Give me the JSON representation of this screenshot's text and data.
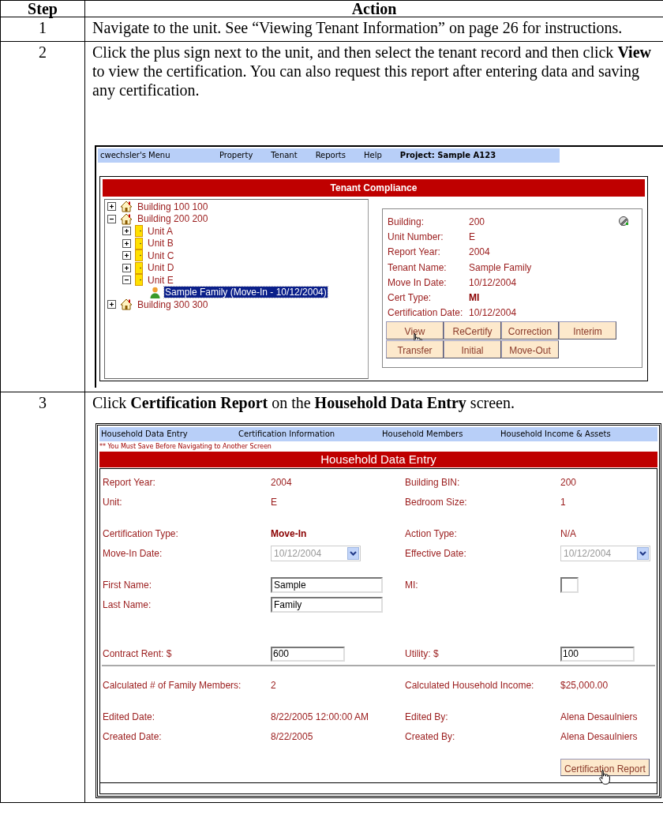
{
  "table": {
    "columns": [
      "Step",
      "Action"
    ],
    "rows": [
      {
        "step": "1",
        "text": "Navigate to the unit. See “Viewing Tenant Information” on page 26 for instructions."
      },
      {
        "step": "2",
        "text": "Click the plus sign next to the unit, and then select the tenant record and then click **View** to view the certification. You can also request this report after entering data and saving any certification.",
        "screen": {
          "kind": "tenant_compliance",
          "menu": [
            "cwechsler's Menu",
            "Property",
            "Tenant",
            "Reports",
            "Help"
          ],
          "project": "Project: Sample A123",
          "title": "Tenant Compliance",
          "tree": [
            {
              "label": "Building 100 100",
              "kind": "building",
              "expanded": false,
              "selected": false
            },
            {
              "label": "Building 200 200",
              "kind": "building",
              "expanded": true,
              "selected": false,
              "children": [
                {
                  "label": "Unit A",
                  "kind": "unit",
                  "expanded": false,
                  "selected": false
                },
                {
                  "label": "Unit B",
                  "kind": "unit",
                  "expanded": false,
                  "selected": false
                },
                {
                  "label": "Unit C",
                  "kind": "unit",
                  "expanded": false,
                  "selected": false
                },
                {
                  "label": "Unit D",
                  "kind": "unit",
                  "expanded": false,
                  "selected": false
                },
                {
                  "label": "Unit E",
                  "kind": "unit",
                  "expanded": true,
                  "selected": false,
                  "children": [
                    {
                      "label": "Sample Family (Move-In - 10/12/2004)",
                      "kind": "tenant",
                      "selected": true
                    }
                  ]
                }
              ]
            },
            {
              "label": "Building 300 300",
              "kind": "building",
              "expanded": false,
              "selected": false
            }
          ],
          "details": [
            {
              "label": "Building:",
              "value": "200",
              "strong": false
            },
            {
              "label": "Unit Number:",
              "value": "E",
              "strong": false
            },
            {
              "label": "Report Year:",
              "value": "2004",
              "strong": false
            },
            {
              "label": "Tenant Name:",
              "value": "Sample Family",
              "strong": false
            },
            {
              "label": "Move In Date:",
              "value": "10/12/2004",
              "strong": false
            },
            {
              "label": "Cert Type:",
              "value": "MI",
              "strong": true
            },
            {
              "label": "Certification Date:",
              "value": "10/12/2004",
              "strong": false
            }
          ],
          "button_rows": [
            [
              {
                "label": "View",
                "pointer": true
              },
              {
                "label": "ReCertify",
                "pointer": false
              },
              {
                "label": "Correction",
                "pointer": false
              },
              {
                "label": "Interim",
                "pointer": false
              }
            ],
            [
              {
                "label": "Transfer",
                "pointer": false
              },
              {
                "label": "Initial",
                "pointer": false
              },
              {
                "label": "Move-Out",
                "pointer": false
              }
            ]
          ]
        }
      },
      {
        "step": "3",
        "text": "Click **Certification Report** on the **Household Data Entry** screen.",
        "screen": {
          "kind": "household_data_entry",
          "nav": [
            "Household Data Entry",
            "Certification Information",
            "Household Members",
            "Household Income & Assets"
          ],
          "warning": "** You Must Save Before Navigating to Another Screen",
          "title": "Household Data Entry",
          "groups": [
            {
              "divider": false,
              "rows": [
                [
                  {
                    "label": "Report Year:",
                    "kind": "text",
                    "value": "2004"
                  },
                  {
                    "label": "Building BIN:",
                    "kind": "text",
                    "value": "200"
                  }
                ],
                [
                  {
                    "label": "Unit:",
                    "kind": "text",
                    "value": "E"
                  },
                  {
                    "label": "Bedroom Size:",
                    "kind": "text",
                    "value": "1"
                  }
                ]
              ]
            },
            {
              "divider": false,
              "rows": [
                [
                  {
                    "label": "Certification Type:",
                    "kind": "strong",
                    "value": "Move-In"
                  },
                  {
                    "label": "Action Type:",
                    "kind": "text",
                    "value": "N/A"
                  }
                ],
                [
                  {
                    "label": "Move-In Date:",
                    "kind": "select",
                    "value": "10/12/2004",
                    "disabled": true
                  },
                  {
                    "label": "Effective Date:",
                    "kind": "select",
                    "value": "10/12/2004",
                    "disabled": true
                  }
                ]
              ]
            },
            {
              "divider": false,
              "rows": [
                [
                  {
                    "label": "First Name:",
                    "kind": "input",
                    "value": "Sample"
                  },
                  {
                    "label": "MI:",
                    "kind": "short_input"
                  }
                ],
                [
                  {
                    "label": "Last Name:",
                    "kind": "input",
                    "value": "Family"
                  }
                ]
              ]
            },
            {
              "divider": false,
              "rows": [
                [
                  {
                    "label": "Contract Rent: $",
                    "kind": "short_text_input",
                    "value": "600"
                  },
                  {
                    "label": "Utility: $",
                    "kind": "short_text_input",
                    "value": "100"
                  }
                ]
              ]
            },
            {
              "divider": true,
              "rows": [
                [
                  {
                    "label": "Calculated # of Family Members:",
                    "kind": "text",
                    "value": "2"
                  },
                  {
                    "label": "Calculated Household Income:",
                    "kind": "text",
                    "value": "$25,000.00"
                  }
                ]
              ]
            },
            {
              "divider": false,
              "rows": [
                [
                  {
                    "label": "Edited Date:",
                    "kind": "text",
                    "value": "8/22/2005 12:00:00 AM"
                  },
                  {
                    "label": "Edited By:",
                    "kind": "text",
                    "value": "Alena Desaulniers"
                  }
                ],
                [
                  {
                    "label": "Created Date:",
                    "kind": "text",
                    "value": "8/22/2005"
                  },
                  {
                    "label": "Created By:",
                    "kind": "text",
                    "value": "Alena Desaulniers"
                  }
                ]
              ]
            }
          ],
          "button": {
            "label": "Certification Report",
            "pointer": true
          }
        }
      }
    ]
  }
}
